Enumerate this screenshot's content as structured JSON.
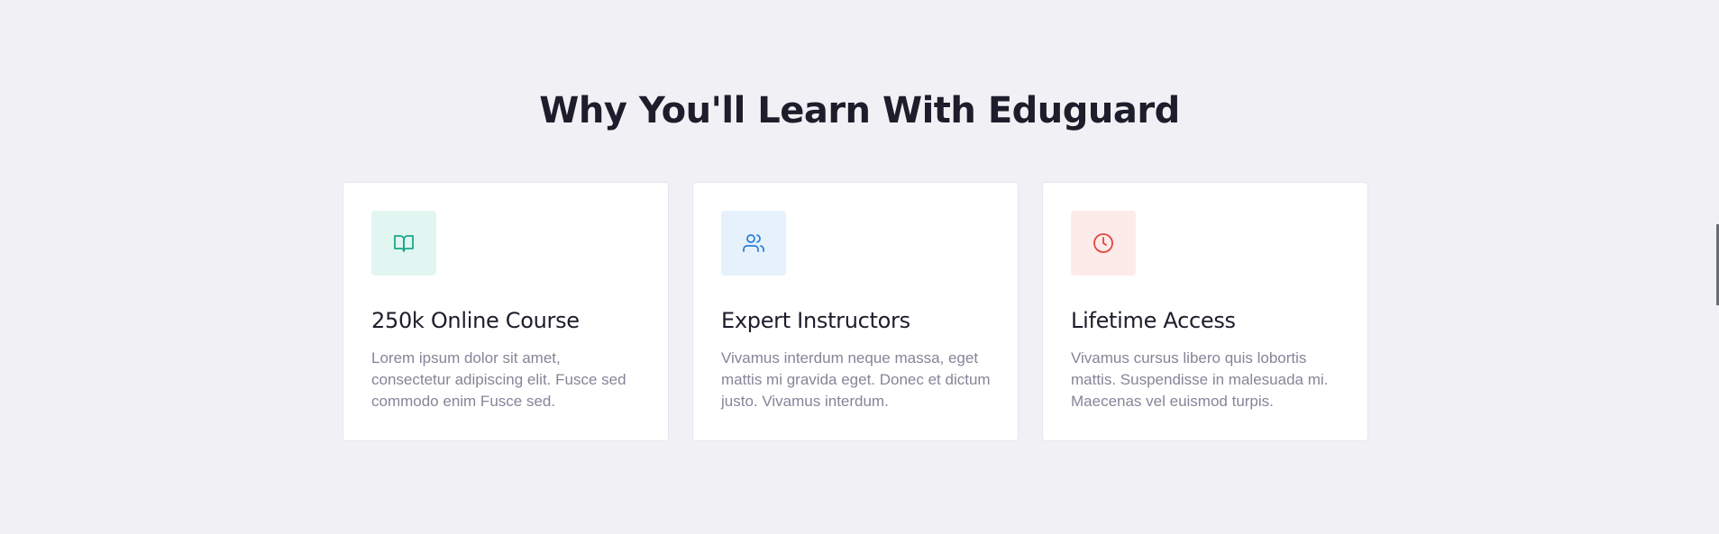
{
  "section": {
    "title": "Why You'll Learn With Eduguard"
  },
  "cards": [
    {
      "title": "250k Online Course",
      "text": "Lorem ipsum dolor sit amet, consectetur adipiscing elit. Fusce sed commodo enim Fusce sed.",
      "icon": "book-open-icon",
      "icon_color": "#1aa88a",
      "icon_bg": "#e2f6f1"
    },
    {
      "title": "Expert Instructors",
      "text": "Vivamus interdum neque massa, eget mattis mi gravida eget. Donec et dictum justo. Vivamus interdum.",
      "icon": "users-icon",
      "icon_color": "#2a7fd6",
      "icon_bg": "#e6f1fc"
    },
    {
      "title": "Lifetime Access",
      "text": "Vivamus cursus libero quis lobortis mattis. Suspendisse in malesuada mi. Maecenas vel euismod turpis.",
      "icon": "clock-icon",
      "icon_color": "#e0463c",
      "icon_bg": "#fdebea"
    }
  ]
}
